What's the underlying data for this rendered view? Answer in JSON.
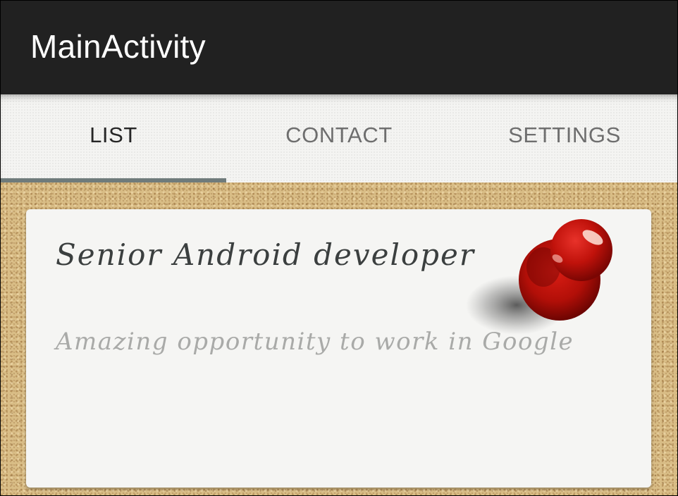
{
  "app_bar": {
    "title": "MainActivity"
  },
  "tabs": [
    {
      "label": "LIST",
      "active": true
    },
    {
      "label": "CONTACT",
      "active": false
    },
    {
      "label": "SETTINGS",
      "active": false
    }
  ],
  "card": {
    "title": "Senior Android developer",
    "subtitle": "Amazing opportunity to work in Google",
    "pin_icon": "red-pushpin-icon"
  },
  "colors": {
    "app_bar": "#212121",
    "tab_indicator": "#6f7b7b",
    "cork_background": "#d9bd86",
    "card": "#f5f5f3",
    "pin": "#c0120b"
  }
}
